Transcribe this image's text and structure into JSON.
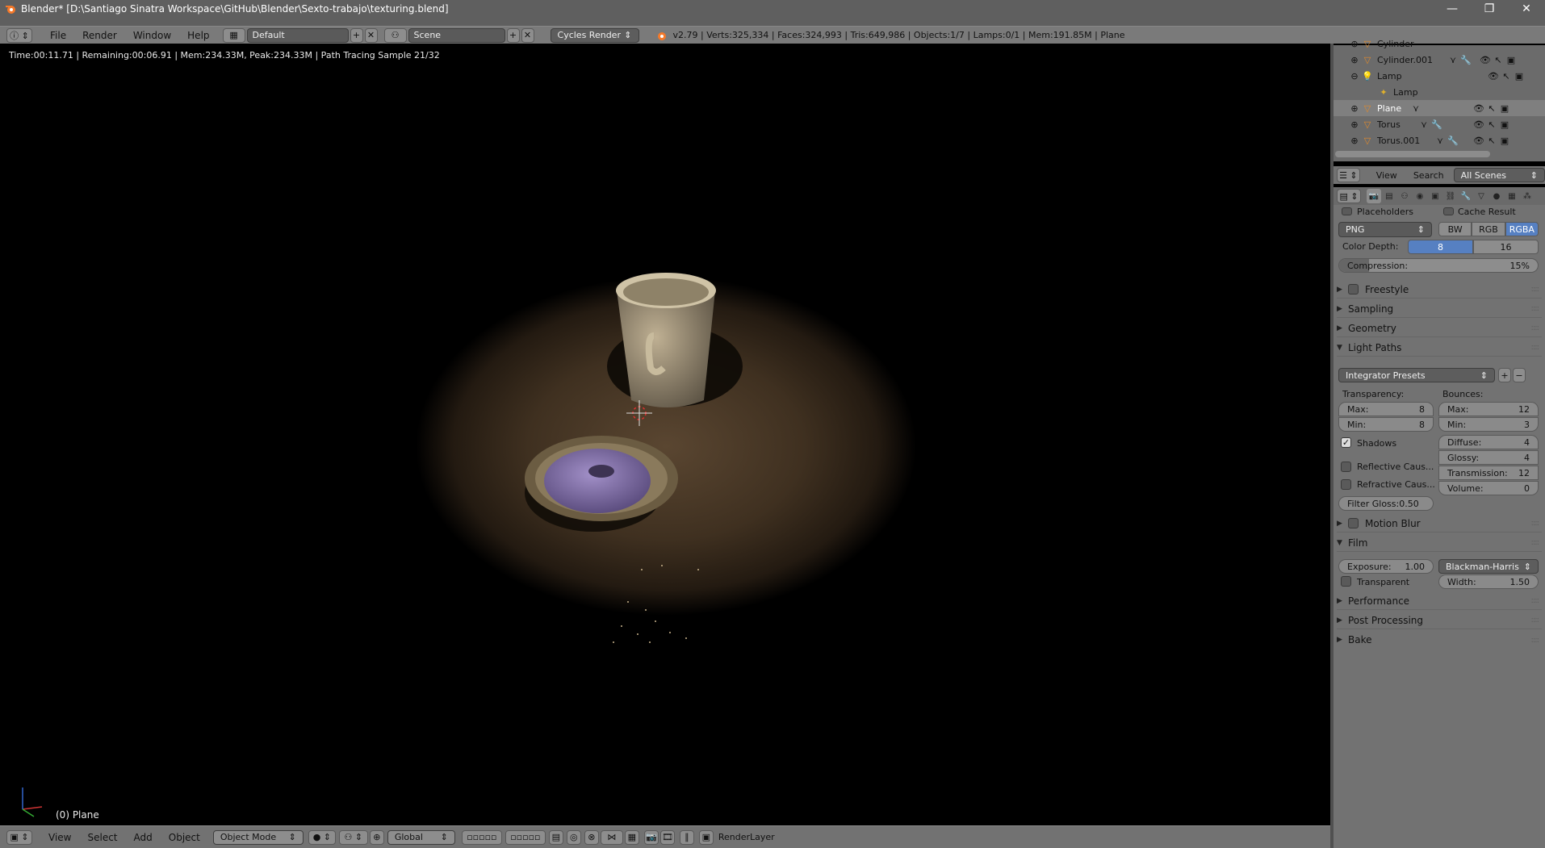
{
  "window": {
    "title": "Blender* [D:\\Santiago Sinatra Workspace\\GitHub\\Blender\\Sexto-trabajo\\texturing.blend]",
    "minimize": "—",
    "restore": "❐",
    "close": "✕"
  },
  "infobar": {
    "menus": [
      "File",
      "Render",
      "Window",
      "Help"
    ],
    "layout": "Default",
    "scene": "Scene",
    "engine": "Cycles Render",
    "stats": "v2.79 | Verts:325,334 | Faces:324,993 | Tris:649,986 | Objects:1/7 | Lamps:0/1 | Mem:191.85M | Plane"
  },
  "viewport": {
    "render_stats": "Time:00:11.71 | Remaining:00:06.91 | Mem:234.33M, Peak:234.33M | Path Tracing Sample 21/32",
    "object_label": "(0) Plane"
  },
  "bottombar": {
    "menus": [
      "View",
      "Select",
      "Add",
      "Object"
    ],
    "mode": "Object Mode",
    "orientation": "Global",
    "render_layer": "RenderLayer"
  },
  "outliner": {
    "rows": [
      {
        "name": "Cylinder",
        "indent": 0
      },
      {
        "name": "Cylinder.001",
        "indent": 0
      },
      {
        "name": "Lamp",
        "indent": 0
      },
      {
        "name": "Lamp",
        "indent": 1
      },
      {
        "name": "Plane",
        "indent": 0
      },
      {
        "name": "Torus",
        "indent": 0
      },
      {
        "name": "Torus.001",
        "indent": 0
      }
    ],
    "header": {
      "view": "View",
      "search": "Search",
      "scenes": "All Scenes"
    }
  },
  "properties": {
    "placeholders": "Placeholders",
    "cache_result": "Cache Result",
    "format": "PNG",
    "color_modes": [
      "BW",
      "RGB",
      "RGBA"
    ],
    "color_depth_label": "Color Depth:",
    "color_depths": [
      "8",
      "16"
    ],
    "compression_label": "Compression:",
    "compression_value": "15%",
    "compression_fraction": 0.15,
    "sections_top": [
      "Freestyle",
      "Sampling",
      "Geometry",
      "Light Paths"
    ],
    "integrator_presets": "Integrator Presets",
    "transparency_label": "Transparency:",
    "bounces_label": "Bounces:",
    "transparency": {
      "max_label": "Max:",
      "max": "8",
      "min_label": "Min:",
      "min": "8"
    },
    "bounces": {
      "max_label": "Max:",
      "max": "12",
      "min_label": "Min:",
      "min": "3",
      "diffuse_label": "Diffuse:",
      "diffuse": "4",
      "glossy_label": "Glossy:",
      "glossy": "4",
      "transmission_label": "Transmission:",
      "transmission": "12",
      "volume_label": "Volume:",
      "volume": "0"
    },
    "shadows": "Shadows",
    "reflective": "Reflective Caus...",
    "refractive": "Refractive Caus...",
    "filter_gloss": "Filter Gloss:0.50",
    "motion_blur": "Motion Blur",
    "film": "Film",
    "exposure_label": "Exposure:",
    "exposure_value": "1.00",
    "filter_type": "Blackman-Harris",
    "transparent": "Transparent",
    "width_label": "Width:",
    "width_value": "1.50",
    "sections_bottom": [
      "Performance",
      "Post Processing",
      "Bake"
    ]
  }
}
